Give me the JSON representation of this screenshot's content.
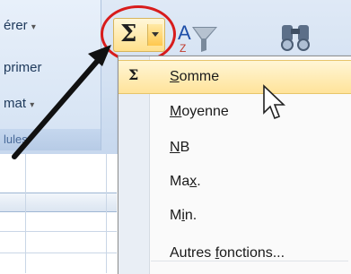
{
  "ribbon": {
    "group_left": {
      "commands": [
        "érer",
        "primer",
        "mat"
      ],
      "caption": "lules"
    },
    "sigma_button": {
      "glyph": "Σ"
    }
  },
  "menu": {
    "items": [
      {
        "label": "Somme",
        "sigma": "Σ"
      },
      {
        "label": "Moyenne"
      },
      {
        "label": "NB"
      },
      {
        "label": "Max."
      },
      {
        "label": "Min."
      },
      {
        "label": "Autres fonctions..."
      }
    ]
  },
  "colors": {
    "highlight": "#ffe39a",
    "annotation_red": "#d81c1c",
    "ribbon_blue": "#d3e1f2"
  }
}
